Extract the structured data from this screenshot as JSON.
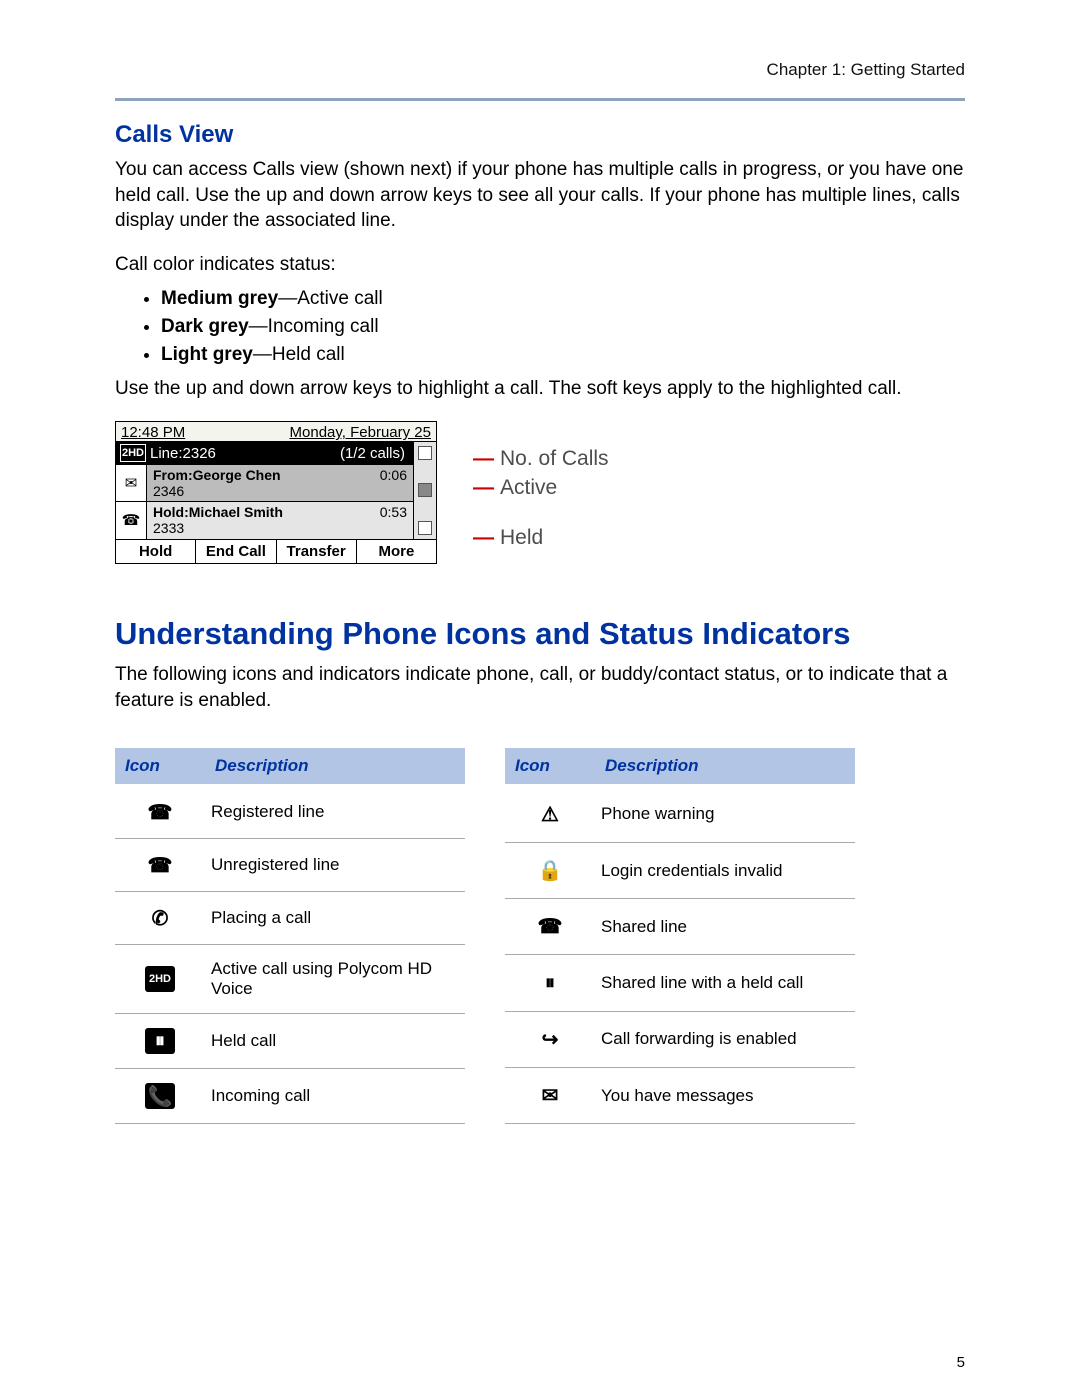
{
  "chapter": "Chapter 1: Getting Started",
  "page_number": "5",
  "calls_view": {
    "heading": "Calls View",
    "intro": "You can access Calls view (shown next) if your phone has multiple calls in progress, or you have one held call. Use the up and down arrow keys to see all your calls. If your phone has multiple lines, calls display under the associated line.",
    "status_line": "Call color indicates status:",
    "bullets": [
      {
        "bold": "Medium grey",
        "rest": "—Active call"
      },
      {
        "bold": "Dark grey",
        "rest": "—Incoming call"
      },
      {
        "bold": "Light grey",
        "rest": "—Held call"
      }
    ],
    "outro": "Use the up and down arrow keys to highlight a call. The soft keys apply to the highlighted call."
  },
  "phone": {
    "time": "12:48 PM",
    "date": "Monday, February 25",
    "hd_label": "2HD",
    "line": "Line:2326",
    "count": "(1/2 calls)",
    "active": {
      "title": "From:George Chen",
      "timer": "0:06",
      "sub": "2346"
    },
    "held": {
      "title": "Hold:Michael Smith",
      "timer": "0:53",
      "sub": "2333"
    },
    "softkeys": [
      "Hold",
      "End Call",
      "Transfer",
      "More"
    ]
  },
  "callouts": {
    "no_of_calls": "No. of Calls",
    "active": "Active",
    "held": "Held"
  },
  "indicators": {
    "heading": "Understanding Phone Icons and Status Indicators",
    "intro": "The following icons and indicators indicate phone, call, or buddy/contact status, or to indicate that a feature is enabled.",
    "col_icon": "Icon",
    "col_desc": "Description",
    "left": [
      {
        "glyph": "☎",
        "cls": "",
        "name": "registered-line-icon",
        "desc": "Registered line"
      },
      {
        "glyph": "☎",
        "cls": "",
        "name": "unregistered-line-icon",
        "desc": "Unregistered line"
      },
      {
        "glyph": "✆",
        "cls": "",
        "name": "placing-call-icon",
        "desc": "Placing a call"
      },
      {
        "glyph": "2HD",
        "cls": "inv",
        "name": "hd-voice-icon",
        "desc": "Active call using Polycom HD Voice"
      },
      {
        "glyph": "⏸",
        "cls": "inv",
        "name": "held-call-icon",
        "desc": "Held call"
      },
      {
        "glyph": "📞",
        "cls": "inv",
        "name": "incoming-call-icon",
        "desc": "Incoming call"
      }
    ],
    "right": [
      {
        "glyph": "⚠",
        "cls": "",
        "name": "phone-warning-icon",
        "desc": "Phone warning"
      },
      {
        "glyph": "🔒",
        "cls": "",
        "name": "login-invalid-icon",
        "desc": "Login credentials invalid"
      },
      {
        "glyph": "☎",
        "cls": "",
        "name": "shared-line-icon",
        "desc": "Shared line"
      },
      {
        "glyph": "⏸",
        "cls": "",
        "name": "shared-held-icon",
        "desc": "Shared line with a held call"
      },
      {
        "glyph": "↪",
        "cls": "",
        "name": "call-forwarding-icon",
        "desc": "Call forwarding is enabled"
      },
      {
        "glyph": "✉",
        "cls": "",
        "name": "messages-icon",
        "desc": "You have messages"
      }
    ]
  }
}
